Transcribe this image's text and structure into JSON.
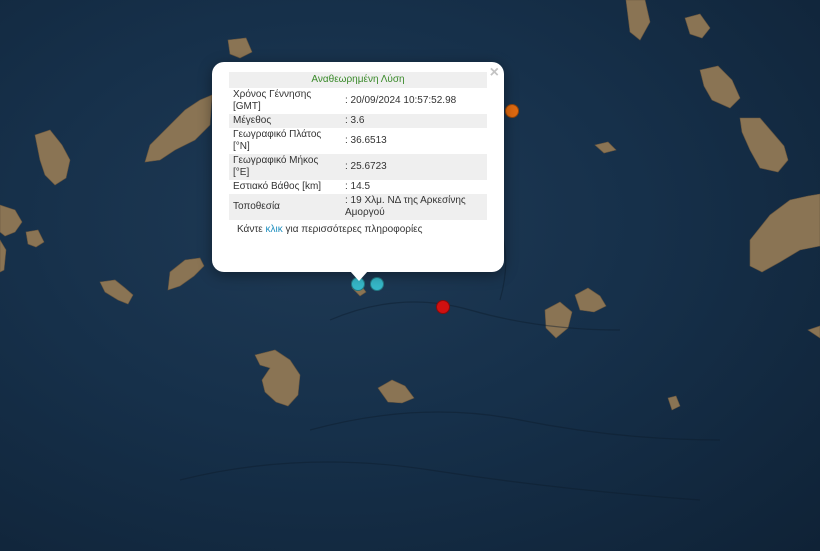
{
  "popup": {
    "close_glyph": "×",
    "status_title": "Αναθεωρημένη Λύση",
    "rows": [
      {
        "key": "Χρόνος Γέννησης [GMT]",
        "value": ": 20/09/2024 10:57:52.98"
      },
      {
        "key": "Μέγεθος",
        "value": ": 3.6"
      },
      {
        "key": "Γεωγραφικό Πλάτος [°N]",
        "value": ": 36.6513"
      },
      {
        "key": "Γεωγραφικό Μήκος [°E]",
        "value": ": 25.6723"
      },
      {
        "key": "Εστιακό Βάθος [km]",
        "value": ": 14.5"
      },
      {
        "key": "Τοποθεσία",
        "value": ": 19 Χλμ. ΝΔ της Αρκεσίνης Αμοργού"
      }
    ],
    "more_before": "Κάντε ",
    "more_link": "κλικ",
    "more_after": " για περισσότερες πληροφορίες"
  },
  "markers": [
    {
      "name": "marker-orange",
      "color": "#e06a10"
    },
    {
      "name": "marker-cyan-selected",
      "color": "#36b8c9"
    },
    {
      "name": "marker-cyan",
      "color": "#36b8c9"
    },
    {
      "name": "marker-red",
      "color": "#d01010"
    }
  ],
  "colors": {
    "sea": "#16304a",
    "land": "#8c7658",
    "status_title": "#3a8a2a",
    "link": "#1f8fbf"
  }
}
